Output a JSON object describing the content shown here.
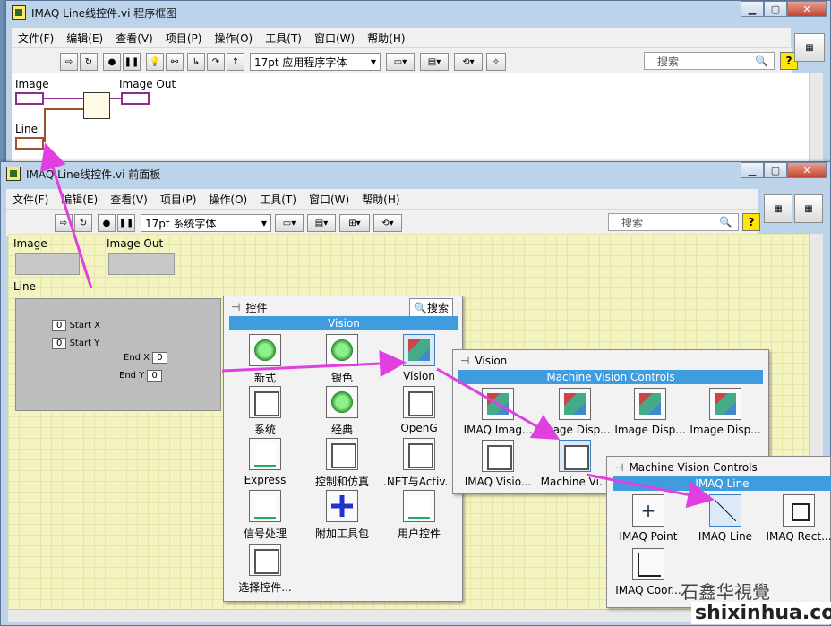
{
  "diagram_window": {
    "title": "IMAQ Line线控件.vi 程序框图",
    "menu": [
      "文件(F)",
      "编辑(E)",
      "查看(V)",
      "项目(P)",
      "操作(O)",
      "工具(T)",
      "窗口(W)",
      "帮助(H)"
    ],
    "font": "17pt 应用程序字体",
    "search_placeholder": "搜索",
    "labels": {
      "image": "Image",
      "image_out": "Image Out",
      "line": "Line"
    }
  },
  "panel_window": {
    "title": "IMAQ Line线控件.vi 前面板",
    "menu": [
      "文件(F)",
      "编辑(E)",
      "查看(V)",
      "项目(P)",
      "操作(O)",
      "工具(T)",
      "窗口(W)",
      "帮助(H)"
    ],
    "font": "17pt 系统字体",
    "search_placeholder": "搜索",
    "labels": {
      "image": "Image",
      "image_out": "Image Out",
      "line": "Line"
    },
    "line_cluster": {
      "fields": [
        {
          "label": "Start X",
          "value": "0"
        },
        {
          "label": "Start Y",
          "value": "0"
        },
        {
          "label": "End X",
          "value": "0"
        },
        {
          "label": "End Y",
          "value": "0"
        }
      ]
    }
  },
  "controls_palette": {
    "title": "控件",
    "search": "搜索",
    "section": "Vision",
    "items": [
      "新式",
      "银色",
      "Vision",
      "系统",
      "经典",
      "OpenG",
      "Express",
      "控制和仿真",
      ".NET与Activ...",
      "信号处理",
      "附加工具包",
      "用户控件",
      "选择控件..."
    ]
  },
  "vision_palette": {
    "title": "Vision",
    "section": "Machine Vision Controls",
    "items": [
      "IMAQ Imag...",
      "Image Disp...",
      "Image Disp...",
      "Image Disp...",
      "IMAQ Visio...",
      "Machine Vi..."
    ]
  },
  "mvc_palette": {
    "title": "Machine Vision Controls",
    "section": "IMAQ Line",
    "items": [
      "IMAQ Point",
      "IMAQ Line",
      "IMAQ Rect...",
      "IMAQ Coor..."
    ]
  },
  "watermark": {
    "text": "石鑫华视觉",
    "url": "shixinhua.com"
  },
  "colors": {
    "arrow": "#e040e0",
    "palette_header": "#3f9ddf"
  }
}
